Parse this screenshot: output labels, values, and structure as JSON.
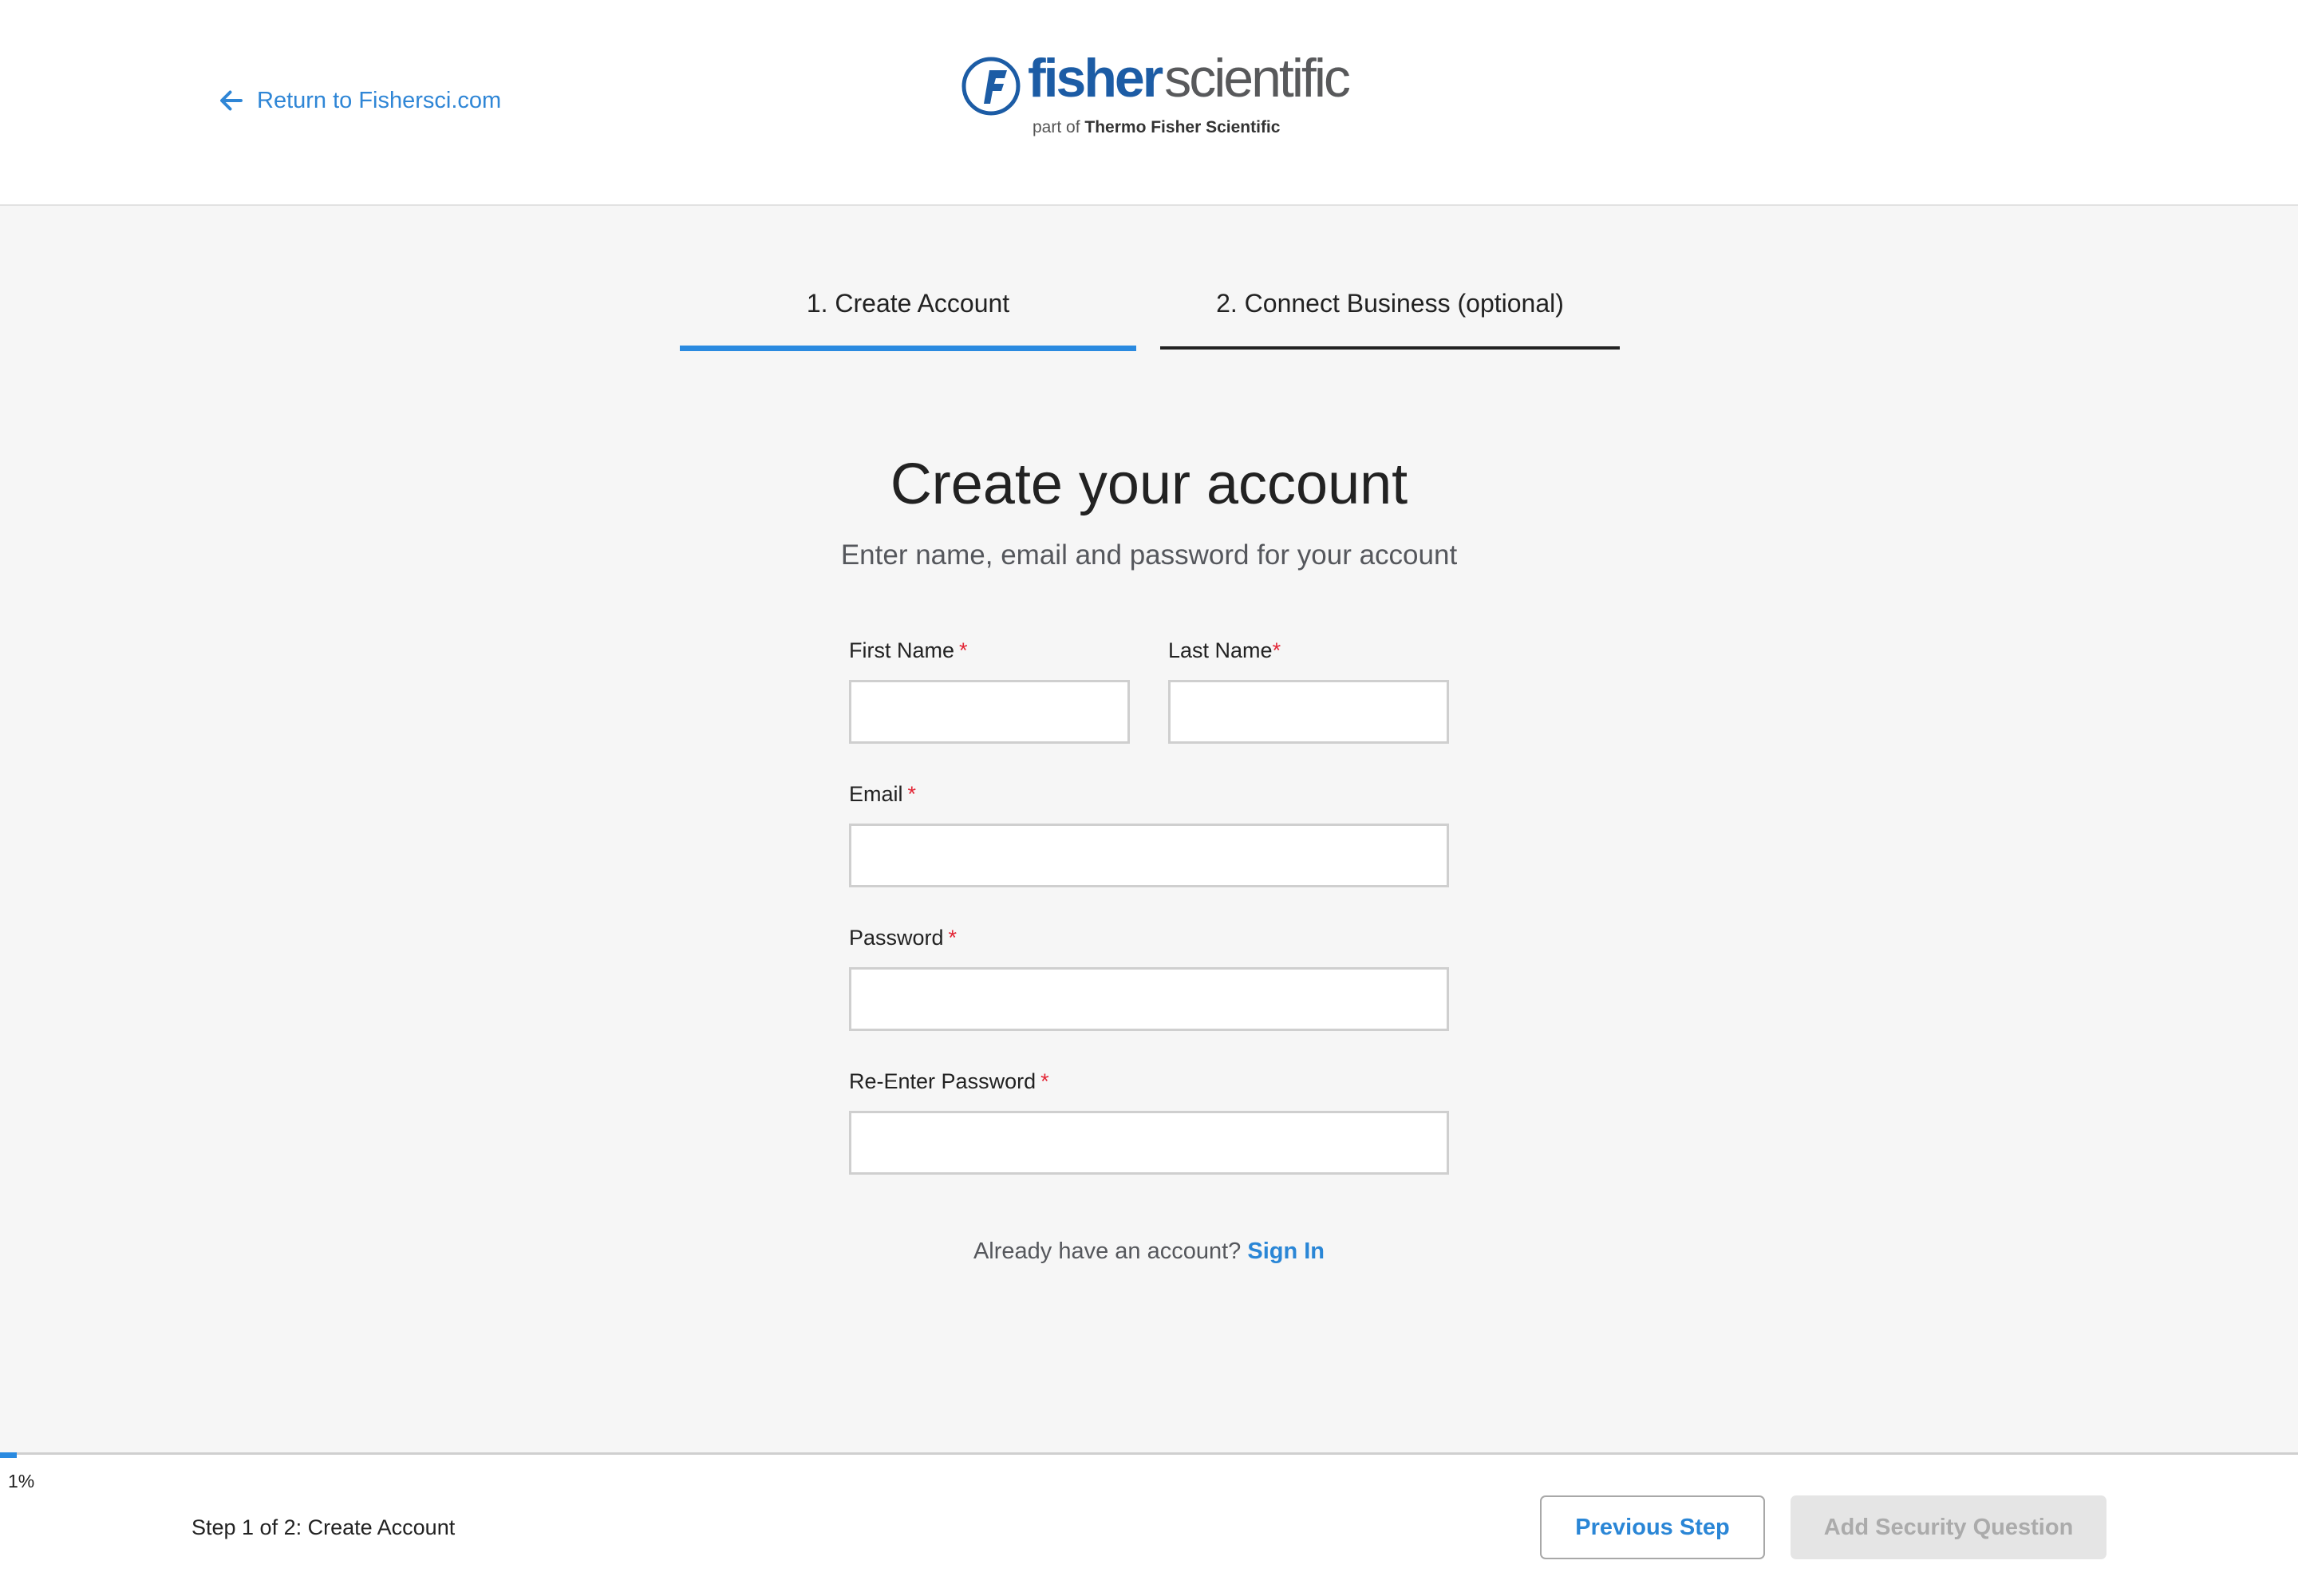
{
  "header": {
    "back_link": {
      "label": "Return to Fishersci.com",
      "icon": "arrow-left-icon"
    },
    "logo": {
      "word_primary": "fisher",
      "word_secondary": "scientific",
      "tagline_prefix": "part of",
      "tagline_brand": "Thermo Fisher Scientific"
    }
  },
  "tabs": [
    {
      "label": "1. Create Account",
      "active": true
    },
    {
      "label": "2. Connect Business (optional)",
      "active": false
    }
  ],
  "main": {
    "title": "Create your account",
    "subtitle": "Enter name, email and password for your account"
  },
  "form": {
    "required_marker": "*",
    "fields": {
      "first_name": {
        "label": "First Name",
        "value": "",
        "required": true
      },
      "last_name": {
        "label": "Last Name",
        "value": "",
        "required": true
      },
      "email": {
        "label": "Email",
        "value": "",
        "required": true
      },
      "password": {
        "label": "Password",
        "value": "",
        "required": true
      },
      "reenter_password": {
        "label": "Re-Enter Password",
        "value": "",
        "required": true
      }
    }
  },
  "signin": {
    "prompt": "Already have an account?",
    "link_label": "Sign In"
  },
  "footer": {
    "progress_percent": 1,
    "progress_label": "1%",
    "step_text": "Step 1 of 2: Create Account",
    "previous_button": "Previous Step",
    "next_button": "Add Security Question",
    "next_disabled": true
  },
  "colors": {
    "accent": "#2a8ae0",
    "link": "#2f86d6",
    "brand_blue": "#1c5ca5",
    "required": "#e32636",
    "disabled_bg": "#e5e5e5",
    "disabled_text": "#ababab"
  }
}
